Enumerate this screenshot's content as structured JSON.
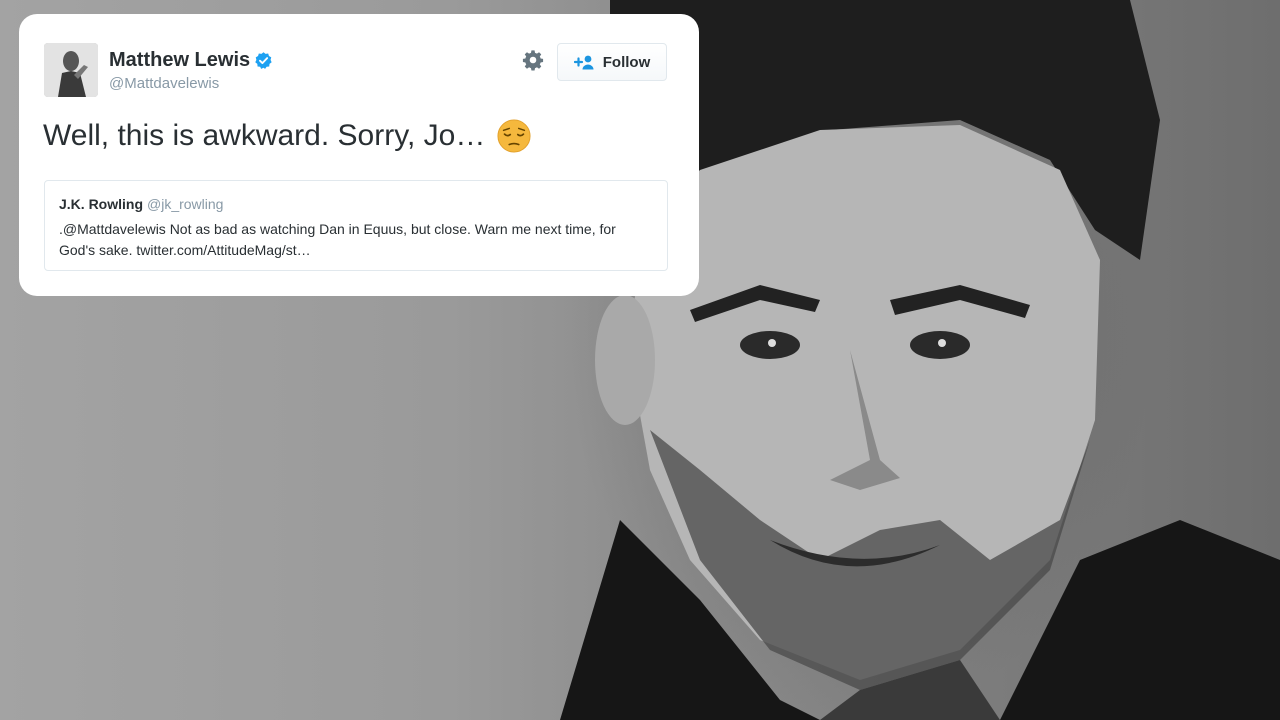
{
  "tweet": {
    "author": {
      "name": "Matthew Lewis",
      "handle": "@Mattdavelewis",
      "verified": true
    },
    "text": "Well, this is awkward. Sorry, Jo…",
    "emoji_icon": "pensive-face-icon",
    "follow_label": "Follow",
    "quoted": {
      "name": "J.K. Rowling",
      "handle": "@jk_rowling",
      "text": ".@Mattdavelewis Not as bad as watching Dan in Equus, but close. Warn me next time, for God's sake. twitter.com/AttitudeMag/st…"
    }
  },
  "icons": {
    "verified": "verified-badge-icon",
    "settings": "gear-icon",
    "follow": "add-user-icon"
  },
  "colors": {
    "card_background": "#ffffff",
    "text_primary": "#292f33",
    "text_secondary": "#8899a6",
    "verified_blue": "#1da1f2",
    "follow_icon_blue": "#1b95e0",
    "border": "#e1e8ed"
  }
}
